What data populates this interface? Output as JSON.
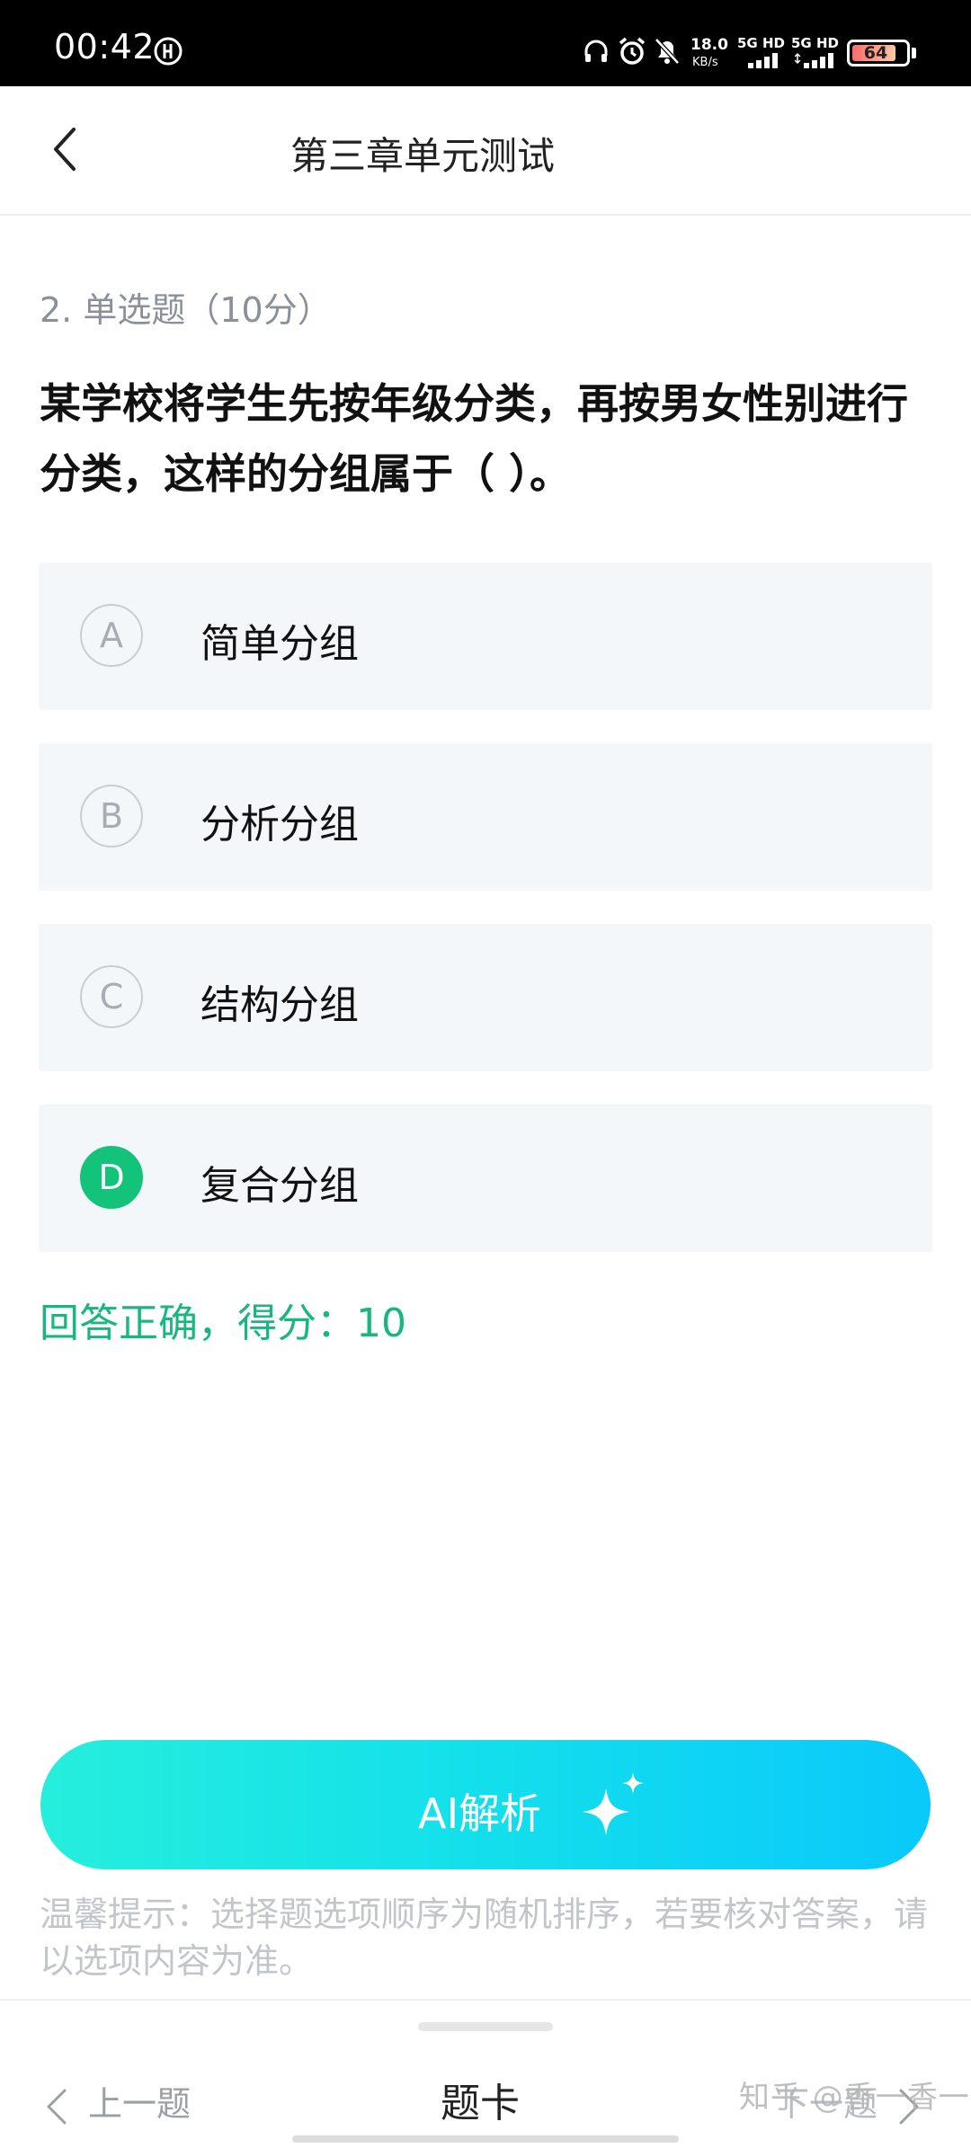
{
  "status_bar": {
    "time": "00:42",
    "net_speed_top": "18.0",
    "net_speed_bottom": "KB/s",
    "sim1": "5G HD",
    "sim2": "5G HD",
    "battery": "64"
  },
  "header": {
    "title": "第三章单元测试"
  },
  "question": {
    "meta": "2. 单选题（10分）",
    "text": "某学校将学生先按年级分类，再按男女性别进行分类，这样的分组属于（ ）。"
  },
  "options": [
    {
      "letter": "A",
      "text": "简单分组",
      "selected": false
    },
    {
      "letter": "B",
      "text": "分析分组",
      "selected": false
    },
    {
      "letter": "C",
      "text": "结构分组",
      "selected": false
    },
    {
      "letter": "D",
      "text": "复合分组",
      "selected": true
    }
  ],
  "result": "回答正确，得分：10",
  "ai_button": {
    "label": "AI解析",
    "icon": "sparkle-icon"
  },
  "tip": "温馨提示：选择题选项顺序为随机排序，若要核对答案，请以选项内容为准。",
  "bottom_bar": {
    "prev": "上一题",
    "card": "题卡",
    "next": "下一题"
  },
  "watermark": "知乎 @香一香一",
  "colors": {
    "accent_green": "#13c37a",
    "ai_gradient_start": "#26eedc",
    "ai_gradient_end": "#0ac9fb"
  }
}
